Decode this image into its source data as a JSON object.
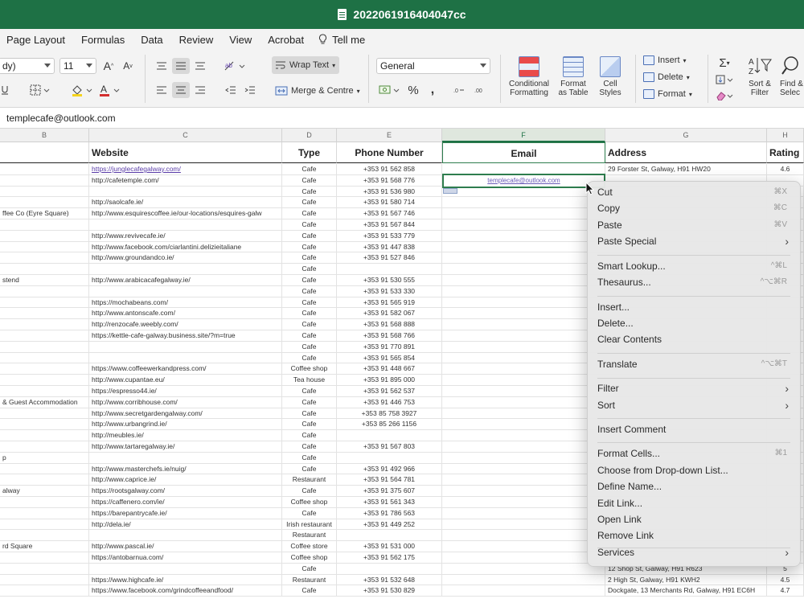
{
  "window": {
    "title": "2022061916404047cc"
  },
  "menubar": {
    "tabs": [
      "Page Layout",
      "Formulas",
      "Data",
      "Review",
      "View",
      "Acrobat"
    ],
    "tell_me": "Tell me"
  },
  "ribbon": {
    "font_name": "dy)",
    "font_size": "11",
    "grow_font": "A",
    "shrink_font": "A",
    "wrap_text": "Wrap Text",
    "merge_centre": "Merge & Centre",
    "number_format": "General",
    "percent": "%",
    "comma": ",",
    "conditional_formatting": [
      "Conditional",
      "Formatting"
    ],
    "format_as_table": [
      "Format",
      "as Table"
    ],
    "cell_styles": [
      "Cell",
      "Styles"
    ],
    "insert": "Insert",
    "delete": "Delete",
    "format": "Format",
    "sort_filter": [
      "Sort &",
      "Filter"
    ],
    "find_select": [
      "Find &",
      "Selec"
    ],
    "sum_symbol": "Σ"
  },
  "formula_bar": {
    "content": "templecafe@outlook.com"
  },
  "columns": {
    "b": "B",
    "c": "C",
    "d": "D",
    "e": "E",
    "f": "F",
    "g": "G",
    "h": "H"
  },
  "table": {
    "headers": {
      "website": "Website",
      "type": "Type",
      "phone": "Phone Number",
      "email": "Email",
      "address": "Address",
      "rating": "Rating"
    },
    "selected_email": "templecafe@outlook.com",
    "rows": [
      {
        "name": "",
        "website": "https://junglecafegalway.com/",
        "type": "Cafe",
        "phone": "+353 91 562 858",
        "address": "29 Forster St, Galway, H91 HW20",
        "rating": "4.6"
      },
      {
        "name": "",
        "website": "http://cafetemple.com/",
        "type": "Cafe",
        "phone": "+353 91 568 776",
        "address": "",
        "rating": ""
      },
      {
        "name": "",
        "website": "",
        "type": "Cafe",
        "phone": "+353 91 536 980",
        "address": "",
        "rating": ""
      },
      {
        "name": "",
        "website": "http://saolcafe.ie/",
        "type": "Cafe",
        "phone": "+353 91 580 714",
        "address": "",
        "rating": ""
      },
      {
        "name": "ffee Co (Eyre Square)",
        "website": "http://www.esquirescoffee.ie/our-locations/esquires-galw",
        "type": "Cafe",
        "phone": "+353 91 567 746",
        "address": "",
        "rating": ""
      },
      {
        "name": "",
        "website": "",
        "type": "Cafe",
        "phone": "+353 91 567 844",
        "address": "",
        "rating": ""
      },
      {
        "name": "",
        "website": "http://www.revivecafe.ie/",
        "type": "Cafe",
        "phone": "+353 91 533 779",
        "address": "",
        "rating": ""
      },
      {
        "name": "",
        "website": "http://www.facebook.com/ciarlantini.delizieitaliane",
        "type": "Cafe",
        "phone": "+353 91 447 838",
        "address": "",
        "rating": ""
      },
      {
        "name": "",
        "website": "http://www.groundandco.ie/",
        "type": "Cafe",
        "phone": "+353 91 527 846",
        "address": "",
        "rating": ""
      },
      {
        "name": "",
        "website": "",
        "type": "Cafe",
        "phone": "",
        "address": "",
        "rating": ""
      },
      {
        "name": "stend",
        "website": "http://www.arabicacafegalway.ie/",
        "type": "Cafe",
        "phone": "+353 91 530 555",
        "address": "",
        "rating": ""
      },
      {
        "name": "",
        "website": "",
        "type": "Cafe",
        "phone": "+353 91 533 330",
        "address": "",
        "rating": ""
      },
      {
        "name": "",
        "website": "https://mochabeans.com/",
        "type": "Cafe",
        "phone": "+353 91 565 919",
        "address": "",
        "rating": ""
      },
      {
        "name": "",
        "website": "http://www.antonscafe.com/",
        "type": "Cafe",
        "phone": "+353 91 582 067",
        "address": "",
        "rating": ""
      },
      {
        "name": "",
        "website": "http://renzocafe.weebly.com/",
        "type": "Cafe",
        "phone": "+353 91 568 888",
        "address": "",
        "rating": ""
      },
      {
        "name": "",
        "website": "https://kettle-cafe-galway.business.site/?m=true",
        "type": "Cafe",
        "phone": "+353 91 568 766",
        "address": "",
        "rating": ""
      },
      {
        "name": "",
        "website": "",
        "type": "Cafe",
        "phone": "+353 91 770 891",
        "address": "",
        "rating": ""
      },
      {
        "name": "",
        "website": "",
        "type": "Cafe",
        "phone": "+353 91 565 854",
        "address": "",
        "rating": ""
      },
      {
        "name": "",
        "website": "https://www.coffeewerkandpress.com/",
        "type": "Coffee shop",
        "phone": "+353 91 448 667",
        "address": "",
        "rating": ""
      },
      {
        "name": "",
        "website": "http://www.cupantae.eu/",
        "type": "Tea house",
        "phone": "+353 91 895 000",
        "address": "",
        "rating": ""
      },
      {
        "name": "",
        "website": "https://espresso44.ie/",
        "type": "Cafe",
        "phone": "+353 91 562 537",
        "address": "",
        "rating": ""
      },
      {
        "name": "& Guest Accommodation",
        "website": "http://www.corribhouse.com/",
        "type": "Cafe",
        "phone": "+353 91 446 753",
        "address": "",
        "rating": ""
      },
      {
        "name": "",
        "website": "http://www.secretgardengalway.com/",
        "type": "Cafe",
        "phone": "+353 85 758 3927",
        "address": "",
        "rating": ""
      },
      {
        "name": "",
        "website": "http://www.urbangrind.ie/",
        "type": "Cafe",
        "phone": "+353 85 266 1156",
        "address": "",
        "rating": ""
      },
      {
        "name": "",
        "website": "http://meubles.ie/",
        "type": "Cafe",
        "phone": "",
        "address": "",
        "rating": ""
      },
      {
        "name": "",
        "website": "http://www.tartaregalway.ie/",
        "type": "Cafe",
        "phone": "+353 91 567 803",
        "address": "",
        "rating": ""
      },
      {
        "name": "p",
        "website": "",
        "type": "Cafe",
        "phone": "",
        "address": "",
        "rating": ""
      },
      {
        "name": "",
        "website": "http://www.masterchefs.ie/nuig/",
        "type": "Cafe",
        "phone": "+353 91 492 966",
        "address": "",
        "rating": ""
      },
      {
        "name": "",
        "website": "http://www.caprice.ie/",
        "type": "Restaurant",
        "phone": "+353 91 564 781",
        "address": "",
        "rating": ""
      },
      {
        "name": "alway",
        "website": "https://rootsgalway.com/",
        "type": "Cafe",
        "phone": "+353 91 375 607",
        "address": "",
        "rating": ""
      },
      {
        "name": "",
        "website": "https://caffenero.com/ie/",
        "type": "Coffee shop",
        "phone": "+353 91 561 343",
        "address": "",
        "rating": ""
      },
      {
        "name": "",
        "website": "https://barepantrycafe.ie/",
        "type": "Cafe",
        "phone": "+353 91 786 563",
        "address": "",
        "rating": ""
      },
      {
        "name": "",
        "website": "http://dela.ie/",
        "type": "Irish restaurant",
        "phone": "+353 91 449 252",
        "address": "",
        "rating": ""
      },
      {
        "name": "",
        "website": "",
        "type": "Restaurant",
        "phone": "",
        "address": "",
        "rating": ""
      },
      {
        "name": "rd Square",
        "website": "http://www.pascal.ie/",
        "type": "Coffee store",
        "phone": "+353 91 531 000",
        "address": "",
        "rating": ""
      },
      {
        "name": "",
        "website": "https://antobarnua.com/",
        "type": "Coffee shop",
        "phone": "+353 91 562 175",
        "address": "",
        "rating": ""
      },
      {
        "name": "",
        "website": "",
        "type": "Cafe",
        "phone": "",
        "address": "12 Shop St, Galway, H91 R623",
        "rating": "5"
      },
      {
        "name": "",
        "website": "https://www.highcafe.ie/",
        "type": "Restaurant",
        "phone": "+353 91 532 648",
        "address": "2 High St, Galway, H91 KWH2",
        "rating": "4.5"
      },
      {
        "name": "",
        "website": "https://www.facebook.com/grindcoffeeandfood/",
        "type": "Cafe",
        "phone": "+353 91 530 829",
        "address": "Dockgate, 13 Merchants Rd, Galway, H91 EC6H",
        "rating": "4.7"
      }
    ]
  },
  "context_menu": {
    "items": {
      "cut": {
        "label": "Cut",
        "shortcut": "⌘X"
      },
      "copy": {
        "label": "Copy",
        "shortcut": "⌘C"
      },
      "paste": {
        "label": "Paste",
        "shortcut": "⌘V"
      },
      "paste_special": {
        "label": "Paste Special"
      },
      "smart_lookup": {
        "label": "Smart Lookup...",
        "shortcut": "^⌘L"
      },
      "thesaurus": {
        "label": "Thesaurus...",
        "shortcut": "^⌥⌘R"
      },
      "insert": {
        "label": "Insert..."
      },
      "delete": {
        "label": "Delete..."
      },
      "clear_contents": {
        "label": "Clear Contents"
      },
      "translate": {
        "label": "Translate",
        "shortcut": "^⌥⌘T"
      },
      "filter": {
        "label": "Filter"
      },
      "sort": {
        "label": "Sort"
      },
      "insert_comment": {
        "label": "Insert Comment"
      },
      "format_cells": {
        "label": "Format Cells...",
        "shortcut": "⌘1"
      },
      "choose_dropdown": {
        "label": "Choose from Drop-down List..."
      },
      "define_name": {
        "label": "Define Name..."
      },
      "edit_link": {
        "label": "Edit Link..."
      },
      "open_link": {
        "label": "Open Link"
      },
      "remove_link": {
        "label": "Remove Link"
      },
      "services": {
        "label": "Services"
      }
    }
  },
  "colors": {
    "excel_green": "#1e7145",
    "selection_border": "#2e7d4e",
    "link_visited": "#5a3da8"
  }
}
